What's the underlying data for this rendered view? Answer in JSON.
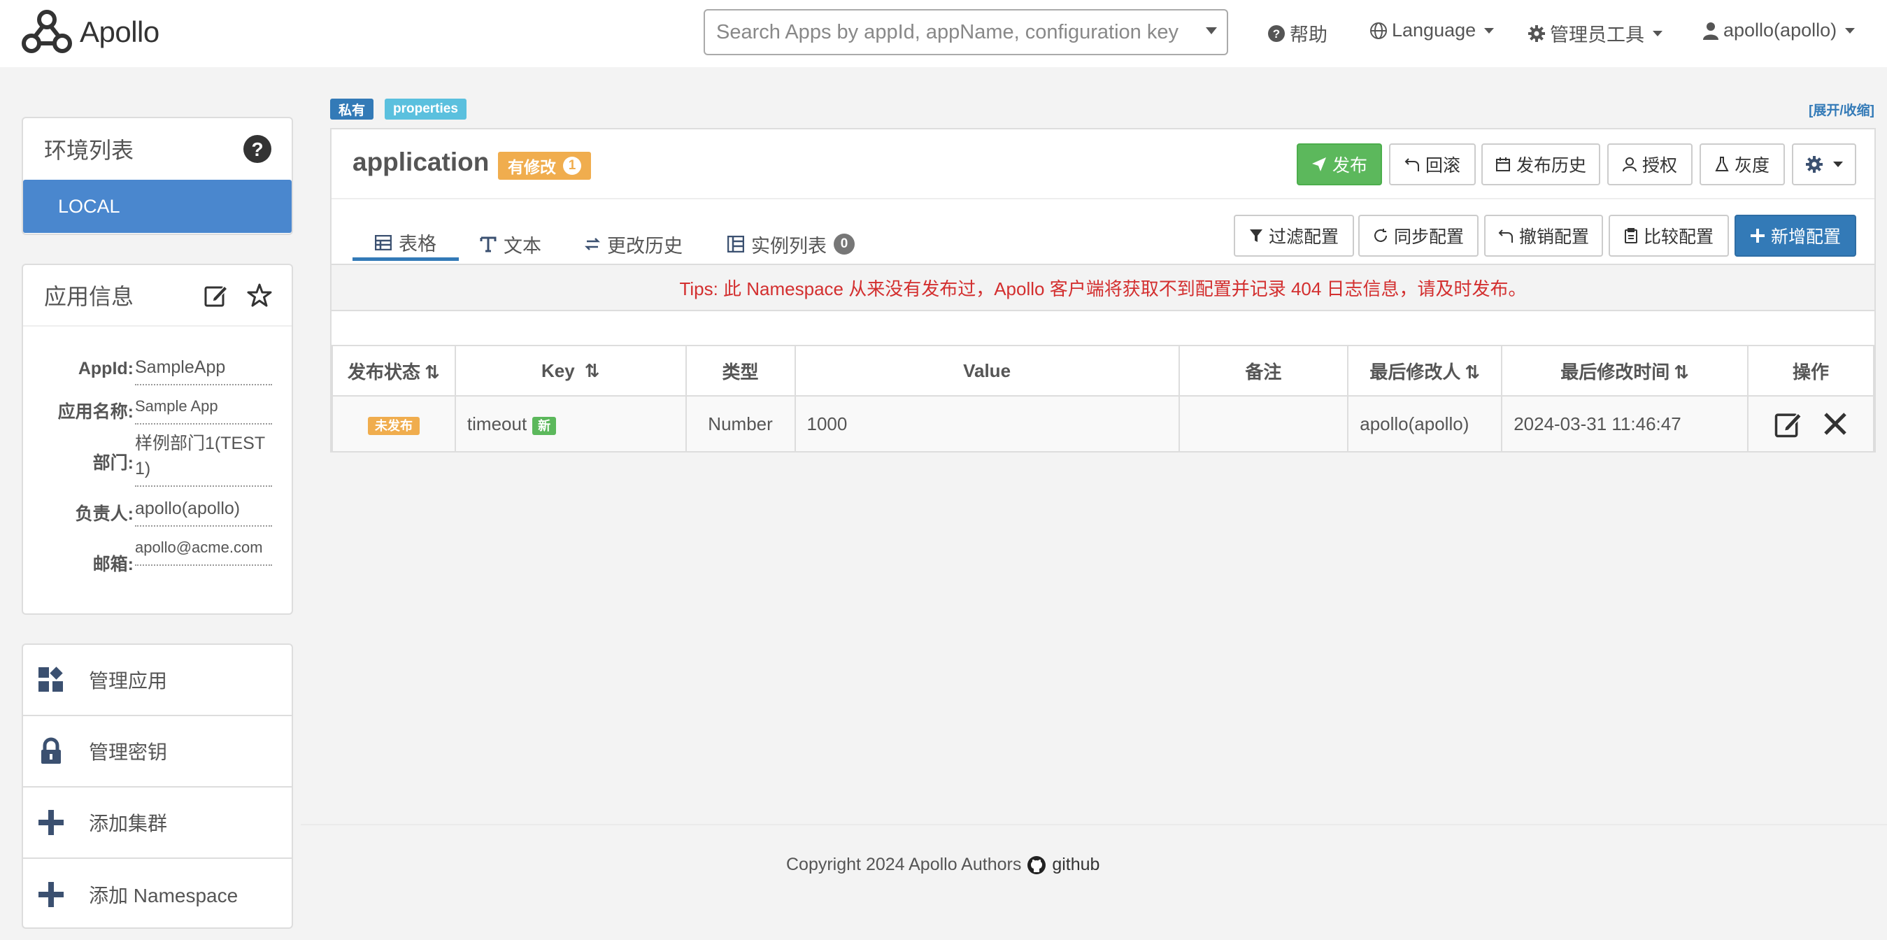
{
  "app": {
    "name": "Apollo"
  },
  "nav": {
    "search_placeholder": "Search Apps by appId, appName, configuration key",
    "help": "帮助",
    "language": "Language",
    "admin_tools": "管理员工具",
    "user": "apollo(apollo)"
  },
  "sidebar": {
    "env_title": "环境列表",
    "envs": [
      "LOCAL"
    ],
    "info_title": "应用信息",
    "info": {
      "appid_label": "AppId:",
      "appid": "SampleApp",
      "appname_label": "应用名称:",
      "appname": "Sample App",
      "dept_label": "部门:",
      "dept": "样例部门1(TEST1)",
      "owner_label": "负责人:",
      "owner": "apollo(apollo)",
      "email_label": "邮箱:",
      "email": "apollo@acme.com"
    },
    "actions": [
      "管理应用",
      "管理密钥",
      "添加集群",
      "添加 Namespace"
    ]
  },
  "namespace": {
    "tag_private": "私有",
    "tag_format": "properties",
    "expand_toggle": "[展开/收缩]",
    "name": "application",
    "modified_label": "有修改",
    "modified_count": "1",
    "buttons": {
      "publish": "发布",
      "rollback": "回滚",
      "history": "发布历史",
      "grant": "授权",
      "gray": "灰度"
    },
    "tabs": {
      "table": "表格",
      "text": "文本",
      "change_history": "更改历史",
      "instances": "实例列表",
      "instances_count": "0"
    },
    "tools": {
      "filter": "过滤配置",
      "sync": "同步配置",
      "revoke": "撤销配置",
      "compare": "比较配置",
      "add": "新增配置"
    },
    "tips": "Tips: 此 Namespace 从来没有发布过，Apollo 客户端将获取不到配置并记录 404 日志信息，请及时发布。",
    "table": {
      "headers": [
        "发布状态",
        "Key",
        "类型",
        "Value",
        "备注",
        "最后修改人",
        "最后修改时间",
        "操作"
      ],
      "rows": [
        {
          "status": "未发布",
          "key": "timeout",
          "key_badge": "新",
          "type": "Number",
          "value": "1000",
          "comment": "",
          "modifier": "apollo(apollo)",
          "modified_time": "2024-03-31 11:46:47"
        }
      ]
    }
  },
  "footer": {
    "copyright": "Copyright 2024 Apollo Authors",
    "link": "github"
  },
  "colors": {
    "primary": "#337ab7",
    "success": "#5cb85c",
    "warning": "#f0ad4e",
    "env_active": "#4a87ce",
    "danger_text": "#d32f2f"
  }
}
